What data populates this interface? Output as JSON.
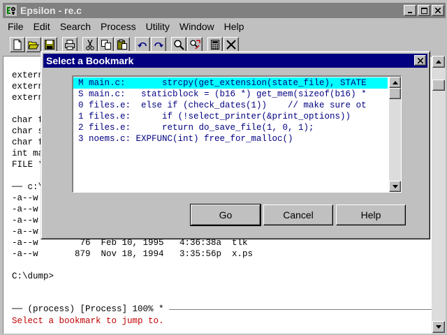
{
  "window": {
    "title": "Epsilon - re.c",
    "icon": "epsilon-app-icon",
    "buttons": [
      "minimize",
      "maximize",
      "close"
    ]
  },
  "menubar": {
    "items": [
      "File",
      "Edit",
      "Search",
      "Process",
      "Utility",
      "Window",
      "Help"
    ]
  },
  "toolbar": {
    "icons": [
      "new-file-icon",
      "open-folder-icon",
      "save-icon",
      "print-icon",
      "cut-icon",
      "copy-icon",
      "paste-icon",
      "undo-icon",
      "redo-icon",
      "find-icon",
      "replace-icon",
      "calculator-icon",
      "close-buffer-icon"
    ]
  },
  "editor": {
    "lines": [
      {
        "text": "extern",
        "row": 1
      },
      {
        "text": "extern",
        "row": 2
      },
      {
        "text": "extern",
        "row": 3
      },
      {
        "text": "char f",
        "row": 5
      },
      {
        "text": "char s",
        "row": 6
      },
      {
        "text": "char f",
        "row": 7
      },
      {
        "text": "int ma",
        "row": 8
      },
      {
        "text": "FILE *",
        "row": 9
      },
      {
        "text": "── c:\\",
        "row": 11
      },
      {
        "text": "-a--w",
        "row": 12
      },
      {
        "text": "-a--w",
        "row": 13
      },
      {
        "text": "-a--w",
        "row": 14
      },
      {
        "text": "-a--w",
        "row": 15
      },
      {
        "text": "-a--w        76  Feb 10, 1995   4:36:38a  tlk",
        "row": 16
      },
      {
        "text": "-a--w       879  Nov 18, 1994   3:35:56p  x.ps",
        "row": 17
      },
      {
        "text": "C:\\dump>",
        "row": 19
      }
    ],
    "modeline": "── (process) [Process] 100% * ",
    "echo_area": "Select a bookmark to jump to."
  },
  "dialog": {
    "title": "Select a Bookmark",
    "items": [
      "M main.c:       strcpy(get_extension(state_file), STATE",
      "S main.c:   staticblock = (b16 *) get_mem(sizeof(b16) *",
      "0 files.e:  else if (check_dates(1))    // make sure ot",
      "1 files.e:      if (!select_printer(&print_options))",
      "2 files.e:      return do_save_file(1, 0, 1);",
      "3 noems.c: EXPFUNC(int) free_for_malloc()"
    ],
    "selected_index": 0,
    "buttons": {
      "go": "Go",
      "cancel": "Cancel",
      "help": "Help"
    }
  },
  "colors": {
    "dialog_title_bg": "#000080",
    "selection_bg": "#00ffff",
    "list_text": "#000080",
    "echo_text": "#c00000"
  }
}
